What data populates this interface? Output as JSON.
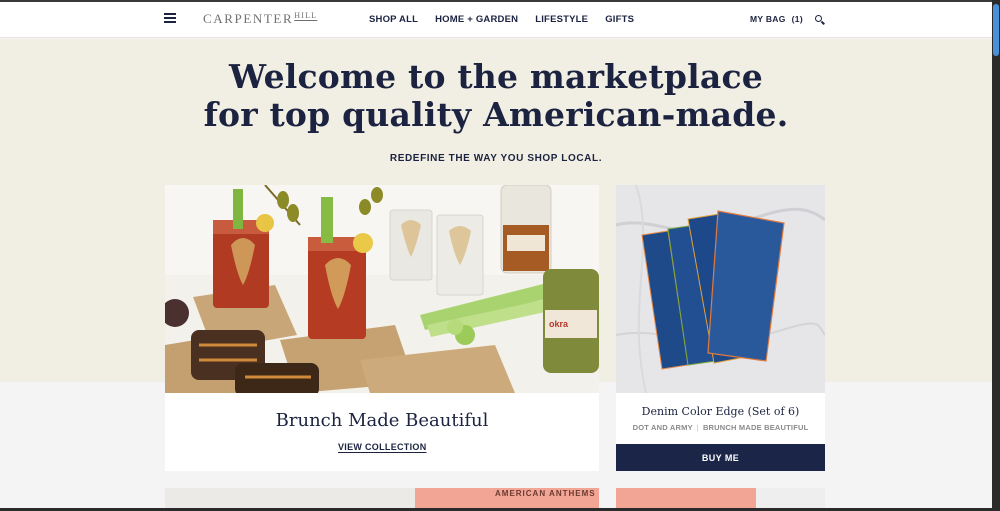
{
  "header": {
    "logo_main": "CARPENTER",
    "logo_sub": "HILL",
    "nav": [
      {
        "label": "SHOP ALL"
      },
      {
        "label": "HOME + GARDEN"
      },
      {
        "label": "LIFESTYLE"
      },
      {
        "label": "GIFTS"
      }
    ],
    "bag_label": "MY BAG",
    "bag_count": "(1)"
  },
  "hero": {
    "headline_line1": "Welcome to the marketplace",
    "headline_line2": "for top quality American-made.",
    "subheading": "REDEFINE THE WAY YOU SHOP LOCAL."
  },
  "feature": {
    "title": "Brunch Made Beautiful",
    "link_label": "VIEW COLLECTION"
  },
  "product": {
    "name": "Denim Color Edge (Set of 6)",
    "brand": "DOT AND ARMY",
    "collection": "BRUNCH MADE BEAUTIFUL",
    "button_label": "BUY ME"
  },
  "peek": {
    "text": "AMERICAN ANTHEMS"
  },
  "colors": {
    "navy": "#1b2548",
    "hero_bg": "#f1eee3",
    "page_bg": "#f4f4f4"
  }
}
